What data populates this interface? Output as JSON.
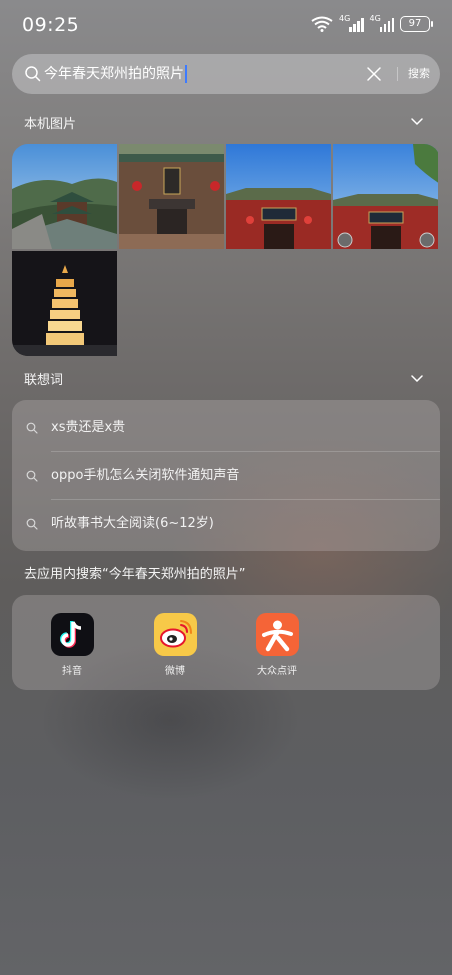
{
  "status_bar": {
    "time": "09:25",
    "network_1": "4G",
    "network_2": "4G",
    "battery": "97"
  },
  "search": {
    "query": "今年春天郑州拍的照片",
    "button_label": "搜索"
  },
  "local_photos": {
    "title": "本机图片",
    "items": [
      "pagoda-mountain",
      "temple-incense-burner",
      "shaolin-gate-1",
      "shaolin-gate-2",
      "night-pagoda"
    ]
  },
  "suggestions": {
    "title": "联想词",
    "items": [
      "xs贵还是x贵",
      "oppo手机怎么关闭软件通知声音",
      "听故事书大全阅读(6~12岁)"
    ]
  },
  "in_app_search": {
    "title": "去应用内搜索“今年春天郑州拍的照片”",
    "apps": [
      {
        "label": "抖音",
        "icon": "douyin-icon"
      },
      {
        "label": "微博",
        "icon": "weibo-icon"
      },
      {
        "label": "大众点评",
        "icon": "dianping-icon"
      }
    ]
  },
  "colors": {
    "cursor": "#3d7bff",
    "dianping": "#f56437",
    "weibo": "#f7c948"
  }
}
